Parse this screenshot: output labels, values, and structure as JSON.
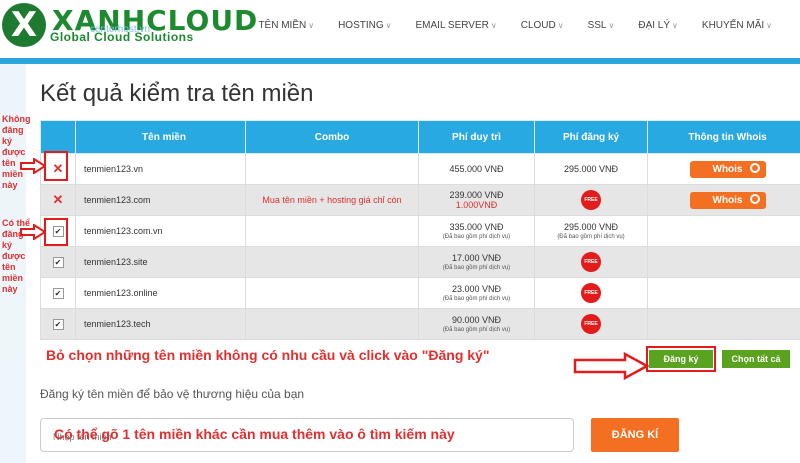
{
  "brand": {
    "main": "XANHCLOUD",
    "sub": "Global Cloud Solutions",
    "faint": "centerhost.vn"
  },
  "nav": [
    {
      "label": "TÊN MIỀN"
    },
    {
      "label": "HOSTING"
    },
    {
      "label": "EMAIL SERVER"
    },
    {
      "label": "CLOUD"
    },
    {
      "label": "SSL"
    },
    {
      "label": "ĐẠI LÝ"
    },
    {
      "label": "KHUYẾN MÃI"
    }
  ],
  "page": {
    "title": "Kết quả kiểm tra tên miền"
  },
  "table": {
    "headers": [
      "",
      "Tên miền",
      "Combo",
      "Phí duy trì",
      "Phí đăng ký",
      "Thông tin Whois"
    ],
    "rows": [
      {
        "status": "unavailable",
        "domain": "tenmien123.vn",
        "combo": "",
        "fee_keep": "455.000 VNĐ",
        "fee_keep_alt": "",
        "fee_keep_note": "",
        "fee_reg": "295.000 VNĐ",
        "fee_reg_note": "",
        "free": false,
        "whois": "Whois"
      },
      {
        "status": "unavailable",
        "domain": "tenmien123.com",
        "combo": "Mua tên miền + hosting giá chỉ còn",
        "fee_keep": "239.000 VNĐ",
        "fee_keep_alt": "1.000VNĐ",
        "fee_keep_note": "",
        "fee_reg": "",
        "fee_reg_note": "",
        "free": true,
        "whois": "Whois"
      },
      {
        "status": "available",
        "domain": "tenmien123.com.vn",
        "combo": "",
        "fee_keep": "335.000 VNĐ",
        "fee_keep_alt": "",
        "fee_keep_note": "(Đã bao gồm phí dịch vụ)",
        "fee_reg": "295.000 VNĐ",
        "fee_reg_note": "(Đã bao gồm phí dịch vụ)",
        "free": false,
        "whois": ""
      },
      {
        "status": "available",
        "domain": "tenmien123.site",
        "combo": "",
        "fee_keep": "17.000 VNĐ",
        "fee_keep_alt": "",
        "fee_keep_note": "(Đã bao gồm phí dịch vụ)",
        "fee_reg": "",
        "fee_reg_note": "",
        "free": true,
        "whois": ""
      },
      {
        "status": "available",
        "domain": "tenmien123.online",
        "combo": "",
        "fee_keep": "23.000 VNĐ",
        "fee_keep_alt": "",
        "fee_keep_note": "(Đã bao gồm phí dịch vụ)",
        "fee_reg": "",
        "fee_reg_note": "",
        "free": true,
        "whois": ""
      },
      {
        "status": "available",
        "domain": "tenmien123.tech",
        "combo": "",
        "fee_keep": "90.000 VNĐ",
        "fee_keep_alt": "",
        "fee_keep_note": "(Đã bao gồm phí dịch vụ)",
        "fee_reg": "",
        "fee_reg_note": "",
        "free": true,
        "whois": ""
      }
    ],
    "free_label": "FREE"
  },
  "annotations": {
    "not_available": "Không đăng ký được tên miền này",
    "available": "Có thể đăng ký được tên miền này",
    "instruction": "Bỏ chọn những tên miền không có nhu cầu và click vào \"Đăng ký\"",
    "search_hint": "Có thể gõ 1 tên miền khác cần mua thêm vào ô tìm kiếm này"
  },
  "actions": {
    "register": "Đăng ký",
    "select_all": "Chọn tất cả"
  },
  "register_section": {
    "subtitle": "Đăng ký tên miền để bảo vệ thương hiệu của bạn",
    "search_placeholder": "Nhập tên miền",
    "search_button": "ĐĂNG KÍ"
  },
  "colors": {
    "accent": "#29a9e1",
    "orange": "#f36f21",
    "green": "#5aa31e",
    "red": "#e31b1b"
  }
}
